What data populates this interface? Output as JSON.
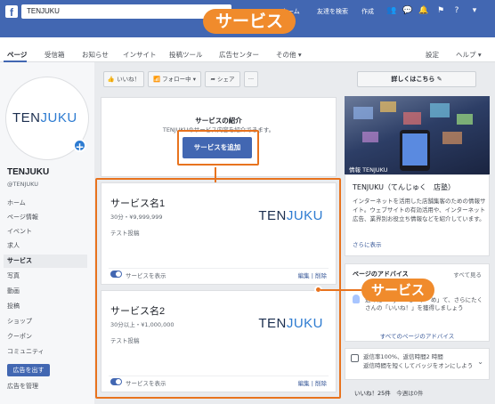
{
  "topbar": {
    "logo": "f",
    "search_value": "TENJUKU",
    "home_label": "ホーム",
    "find_friends": "友達を検索",
    "create": "作成",
    "icons": [
      "friends-icon",
      "messenger-icon",
      "notifications-icon",
      "help-icon",
      "dropdown-icon"
    ]
  },
  "banner": {
    "label": "サービス"
  },
  "tabs": {
    "items": [
      "ページ",
      "受信箱",
      "お知らせ",
      "インサイト",
      "投稿ツール",
      "広告センター",
      "その他 ▾"
    ],
    "right": [
      "設定",
      "ヘルプ ▾"
    ]
  },
  "sidebar": {
    "logo_ten": "TEN",
    "logo_juku": "JUKU",
    "page_name": "TENJUKU",
    "page_handle": "@TENJUKU",
    "items": [
      "ホーム",
      "ページ情報",
      "イベント",
      "求人",
      "サービス",
      "写真",
      "動画",
      "投稿",
      "ショップ",
      "クーポン",
      "コミュニティ"
    ],
    "active_index": 4,
    "promote_button": "広告を出す",
    "manage_ads": "広告を管理"
  },
  "actions": {
    "like": "👍 いいね！",
    "follow": "📶 フォロー中 ▾",
    "share": "➦ シェア",
    "more": "···",
    "detail": "詳しくはこちら ✎"
  },
  "intro": {
    "title": "サービスの紹介",
    "subtitle": "TENJUKUのサービス内容を紹介できます。",
    "add_button": "サービスを追加"
  },
  "services": [
    {
      "name": "サービス名1",
      "price": "30分・¥9,999,999",
      "desc": "テスト投稿",
      "toggle_label": "サービスを表示",
      "edit": "編集",
      "delete": "削除"
    },
    {
      "name": "サービス名2",
      "price": "30分以上・¥1,000,000",
      "desc": "テスト投稿",
      "toggle_label": "サービスを表示",
      "edit": "編集",
      "delete": "削除"
    }
  ],
  "right": {
    "hero_label": "情報 TENJUKU",
    "info_title": "TENJUKU（てんじゅく　店塾）",
    "info_body": "インターネットを活用した店舗集客のための情報サイト。ウェブサイトの有効活用や、インターネット広告、業界別お役立ち情報などを紹介しています。",
    "info_more": "さらに表示",
    "advice_head": "ページのアドバイス",
    "advice_all": "すべて見る",
    "advice_text": "近くにTENJUKUを「い　め」て、さらにたくさんの「いいね！」を獲得しましょう",
    "advice_link": "すべてのページのアドバイス",
    "resp_line1": "返信率100%、返信時間2 時間",
    "resp_line2": "返信時間を短くしてバッジをオンにしよう",
    "like_count": "いいね！25件",
    "like_week": "今週は0件"
  },
  "callout": {
    "label": "サービス"
  },
  "colors": {
    "fb_blue": "#4267b2",
    "accent_orange": "#e8731e",
    "juku_blue": "#2d7bd1"
  }
}
